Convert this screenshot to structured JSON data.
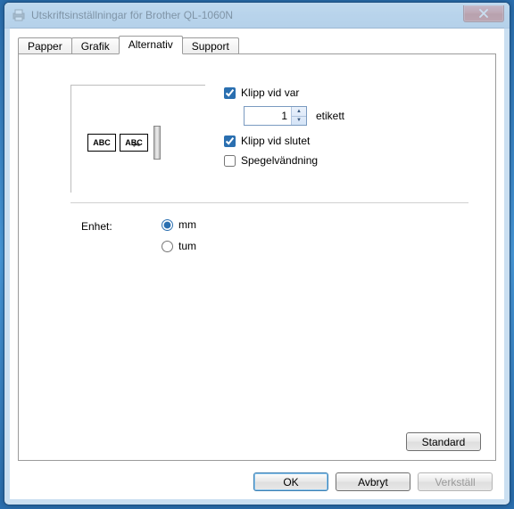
{
  "window": {
    "title": "Utskriftsinställningar för Brother QL-1060N"
  },
  "tabs": {
    "paper": "Papper",
    "graphics": "Grafik",
    "alternative": "Alternativ",
    "support": "Support"
  },
  "preview_label": "ABC",
  "options": {
    "cut_every_label": "Klipp vid var",
    "cut_every_value": "1",
    "cut_every_suffix": "etikett",
    "cut_at_end": "Klipp vid slutet",
    "mirror": "Spegelvändning"
  },
  "unit": {
    "label": "Enhet:",
    "mm": "mm",
    "inch": "tum"
  },
  "buttons": {
    "standard": "Standard",
    "ok": "OK",
    "cancel": "Avbryt",
    "apply": "Verkställ"
  }
}
